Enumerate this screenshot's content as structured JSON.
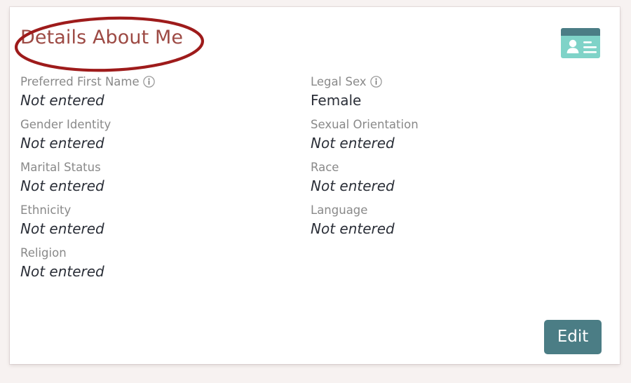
{
  "card": {
    "title": "Details About Me",
    "title_color": "#9d4a44",
    "icon": "id-card-icon",
    "background": "#ffffff"
  },
  "page": {
    "background_color": "#f7f2f1"
  },
  "annotation": {
    "shape": "ellipse",
    "color": "#9e1b1b",
    "target": "Details About Me"
  },
  "fields": {
    "left": [
      {
        "label": "Preferred First Name",
        "value": "Not entered",
        "empty": true,
        "has_info": true
      },
      {
        "label": "Gender Identity",
        "value": "Not entered",
        "empty": true,
        "has_info": false
      },
      {
        "label": "Marital Status",
        "value": "Not entered",
        "empty": true,
        "has_info": false
      },
      {
        "label": "Ethnicity",
        "value": "Not entered",
        "empty": true,
        "has_info": false
      },
      {
        "label": "Religion",
        "value": "Not entered",
        "empty": true,
        "has_info": false
      }
    ],
    "right": [
      {
        "label": "Legal Sex",
        "value": "Female",
        "empty": false,
        "has_info": true
      },
      {
        "label": "Sexual Orientation",
        "value": "Not entered",
        "empty": true,
        "has_info": false
      },
      {
        "label": "Race",
        "value": "Not entered",
        "empty": true,
        "has_info": false
      },
      {
        "label": "Language",
        "value": "Not entered",
        "empty": true,
        "has_info": false
      }
    ]
  },
  "actions": {
    "edit_label": "Edit",
    "edit_color": "#4b7d85"
  },
  "icons": {
    "info": "info-circle-icon",
    "id_card": "id-card-icon"
  },
  "colors": {
    "label": "#898989",
    "value": "#2b2f38",
    "accent_teal": "#4b7d85",
    "icon_teal_light": "#7fd3c8",
    "icon_teal_dark": "#4b7d85",
    "annotation_red": "#9e1b1b"
  }
}
